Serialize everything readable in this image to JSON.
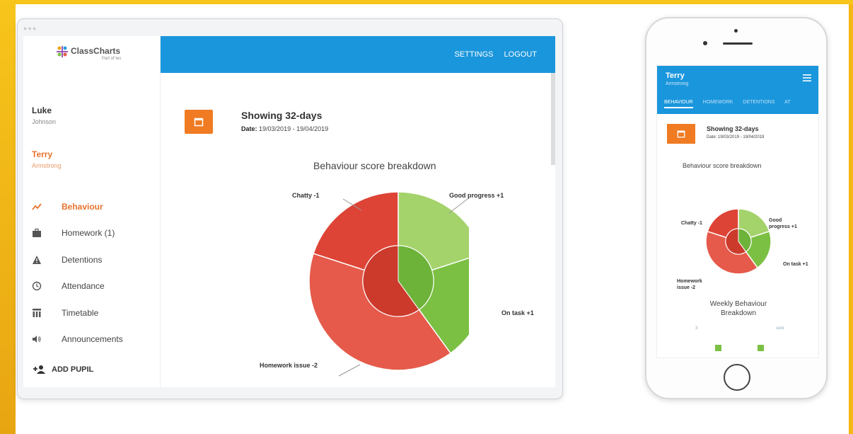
{
  "app": {
    "logo": {
      "name": "ClassCharts",
      "sublabel": "Part of tes"
    },
    "header": {
      "settings_label": "SETTINGS",
      "logout_label": "LOGOUT"
    },
    "pupils": [
      {
        "first_name": "Luke",
        "last_name": "Johnson"
      },
      {
        "first_name": "Terry",
        "last_name": "Armstrong",
        "selected": true
      }
    ],
    "nav": [
      {
        "label": "Behaviour",
        "icon": "trend-line-icon",
        "active": true
      },
      {
        "label": "Homework (1)",
        "icon": "briefcase-icon"
      },
      {
        "label": "Detentions",
        "icon": "warning-icon"
      },
      {
        "label": "Attendance",
        "icon": "clock-icon"
      },
      {
        "label": "Timetable",
        "icon": "timetable-icon"
      },
      {
        "label": "Announcements",
        "icon": "speaker-icon"
      }
    ],
    "add_pupil_label": "ADD PUPIL",
    "showing": {
      "title": "Showing 32-days",
      "date_label": "Date:",
      "date_range": "19/03/2019 - 19/04/2019"
    },
    "colors": {
      "accent_blue": "#1a96dc",
      "accent_orange": "#f07b23",
      "positive_green": "#7bc043",
      "negative_red": "#e0473a"
    }
  },
  "chart_data": {
    "type": "pie",
    "title": "Behaviour score breakdown",
    "slices": [
      {
        "label": "Good progress +1",
        "value": 1,
        "color": "#a4d36b"
      },
      {
        "label": "On task +1",
        "value": 1,
        "color": "#7bc043"
      },
      {
        "label": "Homework issue -2",
        "value": 2,
        "color": "#e55a4a"
      },
      {
        "label": "Chatty -1",
        "value": 1,
        "color": "#dd4436"
      }
    ],
    "inner_ring": {
      "positive": 2,
      "negative": 3
    }
  },
  "mobile": {
    "pupil": {
      "first_name": "Terry",
      "last_name": "Armstrong"
    },
    "tabs": [
      "BEHAVIOUR",
      "HOMEWORK",
      "DETENTIONS",
      "AT"
    ],
    "showing": {
      "title": "Showing 32-days",
      "date": "Date: 19/03/2019 - 19/04/2019"
    },
    "chart_title": "Behaviour score breakdown",
    "labels": {
      "chatty": "Chatty -1",
      "good_line1": "Good",
      "good_line2": "progress +1",
      "on_task": "On task +1",
      "homework_line1": "Homework",
      "homework_line2": "issue -2"
    },
    "weekly_title_line1": "Weekly Behaviour",
    "weekly_title_line2": "Breakdown",
    "weekly_axis_left": "3",
    "weekly_axis_right": "cure"
  }
}
